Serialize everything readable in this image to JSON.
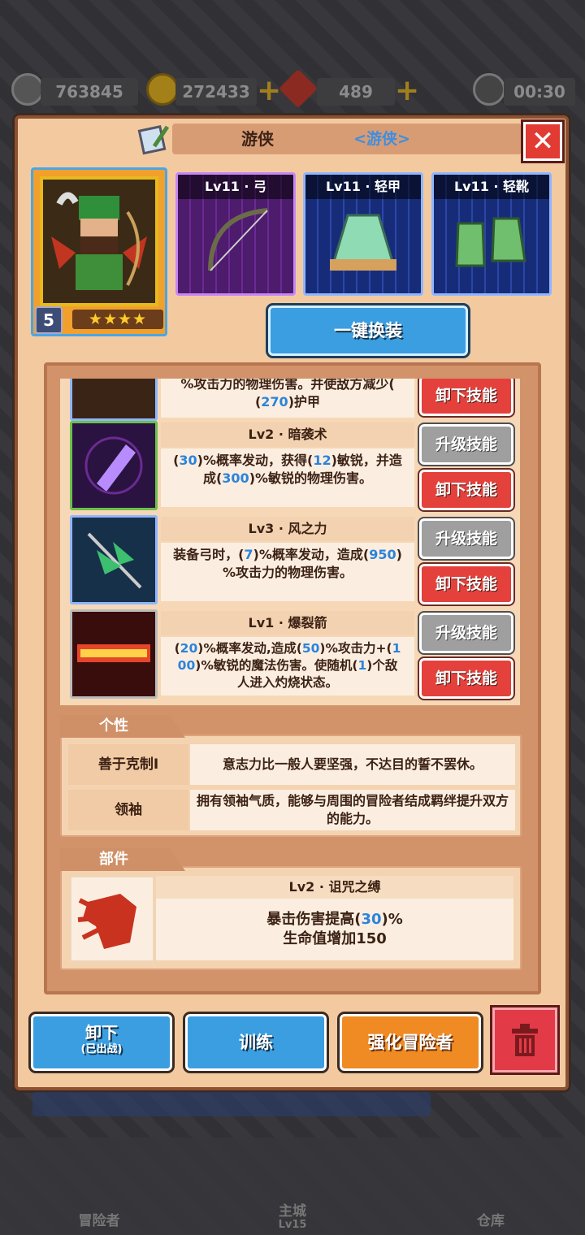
{
  "resources": {
    "power": "763845",
    "gold": "272433",
    "gems": "489",
    "timer": "00:30"
  },
  "header": {
    "title": "游侠",
    "class_tag": "<游侠>"
  },
  "hero": {
    "level": "5",
    "stars": "★★★★"
  },
  "equipment": [
    {
      "label": "Lv11 · 弓"
    },
    {
      "label": "Lv11 · 轻甲"
    },
    {
      "label": "Lv11 · 轻靴"
    }
  ],
  "one_key_equip": "一键换装",
  "skills": {
    "partial_desc_line1": "%攻击力的物理伤害。并使敌方减少(",
    "partial_desc_line2_num": "270",
    "partial_desc_line2_rest": ")护甲",
    "unequip_label": "卸下技能",
    "upgrade_label": "升级技能",
    "items": [
      {
        "name": "Lv2 · 暗袭术",
        "desc_a": "(",
        "n1": "30",
        "desc_b": ")%概率发动，获得(",
        "n2": "12",
        "desc_c": ")敏锐，并造",
        "desc_d": "成(",
        "n3": "300",
        "desc_e": ")%敏锐的物理伤害。"
      },
      {
        "name": "Lv3 · 风之力",
        "desc_a": "装备弓时，(",
        "n1": "7",
        "desc_b": ")%概率发动，造成(",
        "n2": "950",
        "desc_c": ")",
        "desc_d": "%攻击力的物理伤害。"
      },
      {
        "name": "Lv1 · 爆裂箭",
        "desc_a": "(",
        "n1": "20",
        "desc_b": ")%概率发动,造成(",
        "n2": "50",
        "desc_c": ")%攻击力+(",
        "n3a": "1",
        "n3b": "00",
        "desc_d": ")%敏锐的魔法伤害。使随机(",
        "n4": "1",
        "desc_e": ")个敌",
        "desc_f": "人进入灼烧状态。"
      }
    ]
  },
  "personality": {
    "tag": "个性",
    "traits": [
      {
        "key": "善于克制I",
        "value": "意志力比一般人要坚强，不达目的誓不罢休。"
      },
      {
        "key": "领袖",
        "value": "拥有领袖气质，能够与周围的冒险者结成羁绊提升双方的能力。"
      }
    ]
  },
  "parts": {
    "tag": "部件",
    "name": "Lv2 · 诅咒之缚",
    "line1_a": "暴击伤害提高(",
    "line1_num": "30",
    "line1_b": ")%",
    "line2": "生命值增加150"
  },
  "buttons": {
    "unequip": "卸下",
    "unequip_sub": "(已出战)",
    "train": "训练",
    "enhance": "强化冒险者"
  },
  "nav": {
    "adventurers": "冒险者",
    "main_city": "主城",
    "main_city_level": "Lv15",
    "warehouse": "仓库"
  }
}
